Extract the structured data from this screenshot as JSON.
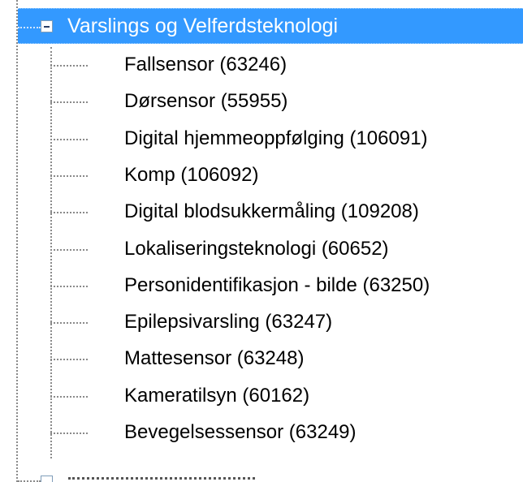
{
  "tree": {
    "parent": {
      "label": "Varslings og Velferdsteknologi",
      "expanded": true,
      "selected": true,
      "expander_icon": "minus-box-icon"
    },
    "children": [
      {
        "label": "Fallsensor (63246)"
      },
      {
        "label": "Dørsensor (55955)"
      },
      {
        "label": "Digital hjemmeoppfølging (106091)"
      },
      {
        "label": "Komp (106092)"
      },
      {
        "label": "Digital blodsukkermåling (109208)"
      },
      {
        "label": "Lokaliseringsteknologi (60652)"
      },
      {
        "label": "Personidentifikasjon - bilde (63250)"
      },
      {
        "label": "Epilepsivarsling (63247)"
      },
      {
        "label": "Mattesensor (63248)"
      },
      {
        "label": "Kameratilsyn (60162)"
      },
      {
        "label": "Bevegelsessensor (63249)"
      }
    ]
  },
  "colors": {
    "selection": "#3399ff",
    "selection_text": "#ffffff",
    "text": "#000000",
    "guide_lines": "#8a8a8a"
  }
}
